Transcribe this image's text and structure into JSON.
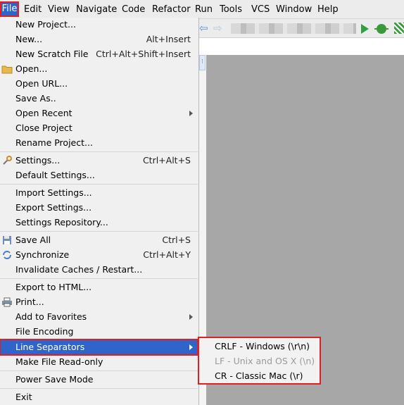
{
  "menubar": {
    "items": [
      {
        "label": "File"
      },
      {
        "label": "Edit"
      },
      {
        "label": "View"
      },
      {
        "label": "Navigate"
      },
      {
        "label": "Code"
      },
      {
        "label": "Refactor"
      },
      {
        "label": "Run"
      },
      {
        "label": "Tools"
      },
      {
        "label": "VCS"
      },
      {
        "label": "Window"
      },
      {
        "label": "Help"
      }
    ]
  },
  "file_menu": {
    "items": [
      {
        "label": "New Project...",
        "shortcut": ""
      },
      {
        "label": "New...",
        "shortcut": "Alt+Insert"
      },
      {
        "label": "New Scratch File",
        "shortcut": "Ctrl+Alt+Shift+Insert"
      },
      {
        "label": "Open...",
        "shortcut": "",
        "icon": "folder-icon"
      },
      {
        "label": "Open URL...",
        "shortcut": ""
      },
      {
        "label": "Save As..",
        "shortcut": ""
      },
      {
        "label": "Open Recent",
        "shortcut": "",
        "submenu": true
      },
      {
        "label": "Close Project",
        "shortcut": ""
      },
      {
        "label": "Rename Project...",
        "shortcut": ""
      },
      {
        "label": "Settings...",
        "shortcut": "Ctrl+Alt+S",
        "icon": "wrench-icon"
      },
      {
        "label": "Default Settings...",
        "shortcut": ""
      },
      {
        "label": "Import Settings...",
        "shortcut": ""
      },
      {
        "label": "Export Settings...",
        "shortcut": ""
      },
      {
        "label": "Settings Repository...",
        "shortcut": ""
      },
      {
        "label": "Save All",
        "shortcut": "Ctrl+S",
        "icon": "floppy-icon"
      },
      {
        "label": "Synchronize",
        "shortcut": "Ctrl+Alt+Y",
        "icon": "sync-icon"
      },
      {
        "label": "Invalidate Caches / Restart...",
        "shortcut": ""
      },
      {
        "label": "Export to HTML...",
        "shortcut": ""
      },
      {
        "label": "Print...",
        "shortcut": "",
        "icon": "printer-icon"
      },
      {
        "label": "Add to Favorites",
        "shortcut": "",
        "submenu": true
      },
      {
        "label": "File Encoding",
        "shortcut": ""
      },
      {
        "label": "Line Separators",
        "shortcut": "",
        "submenu": true,
        "highlighted": true
      },
      {
        "label": "Make File Read-only",
        "shortcut": ""
      },
      {
        "label": "Power Save Mode",
        "shortcut": ""
      },
      {
        "label": "Exit",
        "shortcut": ""
      }
    ]
  },
  "line_separators_submenu": {
    "items": [
      {
        "label": "CRLF - Windows (\\r\\n)",
        "enabled": true
      },
      {
        "label": "LF - Unix and OS X (\\n)",
        "enabled": false
      },
      {
        "label": "CR - Classic Mac (\\r)",
        "enabled": true
      }
    ]
  },
  "colors": {
    "highlight": "#2f65ca",
    "annotation_red": "#e02020",
    "run_green": "#2ea043"
  }
}
